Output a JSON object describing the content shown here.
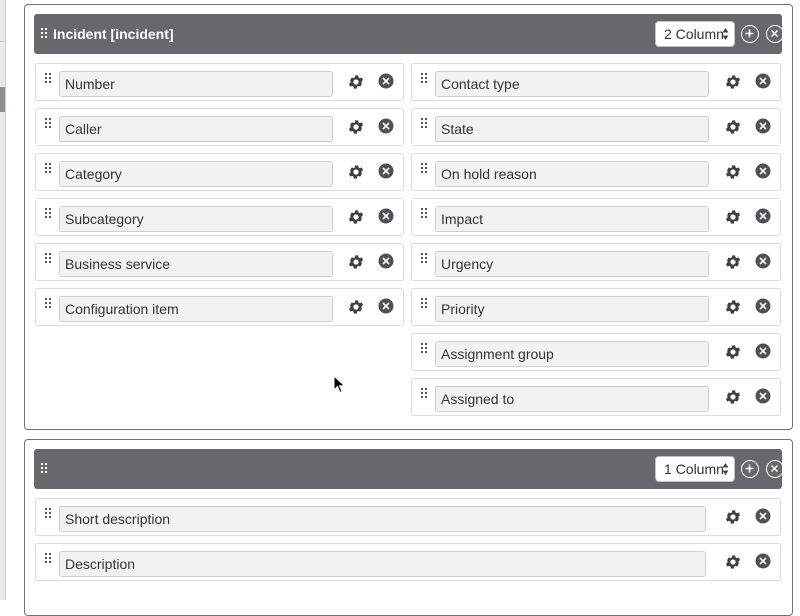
{
  "section1": {
    "title": "Incident [incident]",
    "columns_select": "2 Column",
    "left_fields": [
      "Number",
      "Caller",
      "Category",
      "Subcategory",
      "Business service",
      "Configuration item"
    ],
    "right_fields": [
      "Contact type",
      "State",
      "On hold reason",
      "Impact",
      "Urgency",
      "Priority",
      "Assignment group",
      "Assigned to"
    ]
  },
  "section2": {
    "title": "",
    "columns_select": "1 Column",
    "fields": [
      "Short description",
      "Description"
    ]
  },
  "icons": {
    "drag": "drag-handle-icon",
    "settings": "gear-icon",
    "remove": "close-icon",
    "add": "add-icon",
    "updown": "updown-arrows-icon"
  },
  "colors": {
    "header_bg": "#67676e",
    "remove_icon": "#4f5158",
    "gear_icon": "#3f4046"
  }
}
